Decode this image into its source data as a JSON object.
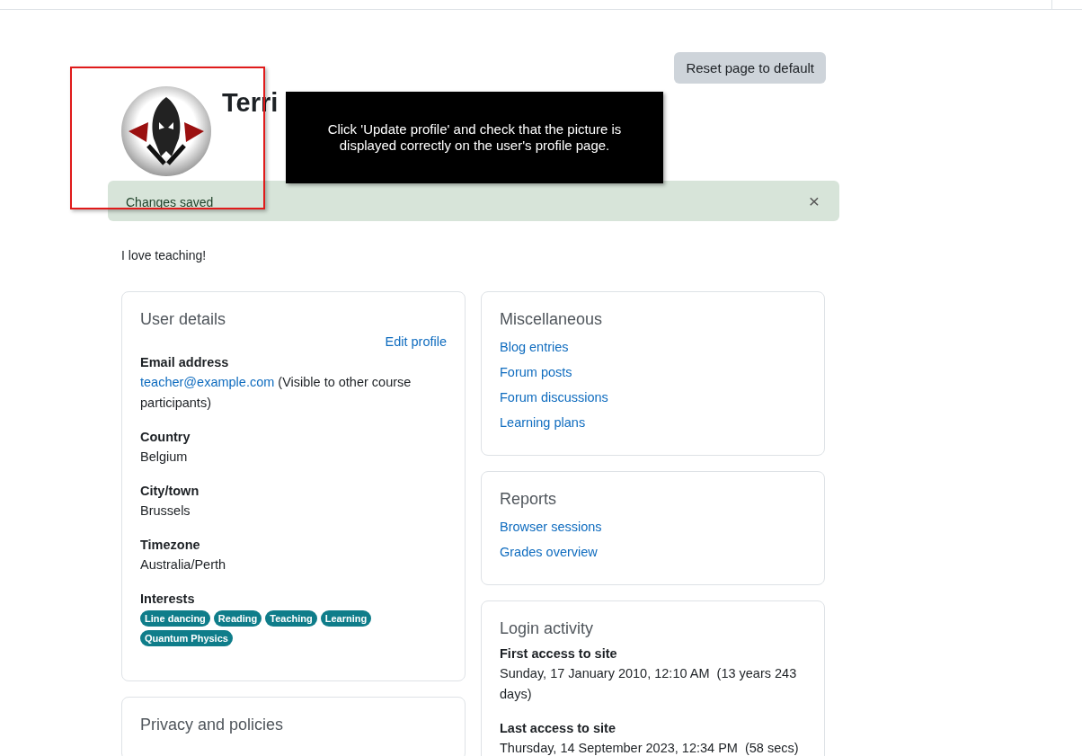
{
  "header": {
    "reset_button": "Reset page to default",
    "user_name": "Terri"
  },
  "tour_step": {
    "text": "Click 'Update profile' and check that the picture is displayed correctly on the user's profile page."
  },
  "alert": {
    "message": "Changes saved",
    "close": "×"
  },
  "description": "I love teaching!",
  "columns": [
    {
      "cards": [
        {
          "title": "User details",
          "edit_link": "Edit profile",
          "fields": [
            {
              "kind": "email",
              "label": "Email address",
              "link": "teacher@example.com",
              "note": "(Visible to other course participants)"
            },
            {
              "kind": "text",
              "label": "Country",
              "value": "Belgium"
            },
            {
              "kind": "text",
              "label": "City/town",
              "value": "Brussels"
            },
            {
              "kind": "text",
              "label": "Timezone",
              "value": "Australia/Perth"
            },
            {
              "kind": "tags",
              "label": "Interests",
              "tags": [
                "Line dancing",
                "Reading",
                "Teaching",
                "Learning",
                "Quantum Physics"
              ]
            }
          ]
        },
        {
          "title": "Privacy and policies"
        }
      ]
    },
    {
      "cards": [
        {
          "title": "Miscellaneous",
          "links": [
            "Blog entries",
            "Forum posts",
            "Forum discussions",
            "Learning plans"
          ]
        },
        {
          "title": "Reports",
          "links": [
            "Browser sessions",
            "Grades overview"
          ]
        },
        {
          "title": "Login activity",
          "fields": [
            {
              "kind": "text",
              "label": "First access to site",
              "value": "Sunday, 17 January 2010, 12:10 AM  (13 years 243 days)"
            },
            {
              "kind": "text",
              "label": "Last access to site",
              "value": "Thursday, 14 September 2023, 12:34 PM  (58 secs)"
            }
          ]
        }
      ]
    }
  ]
}
